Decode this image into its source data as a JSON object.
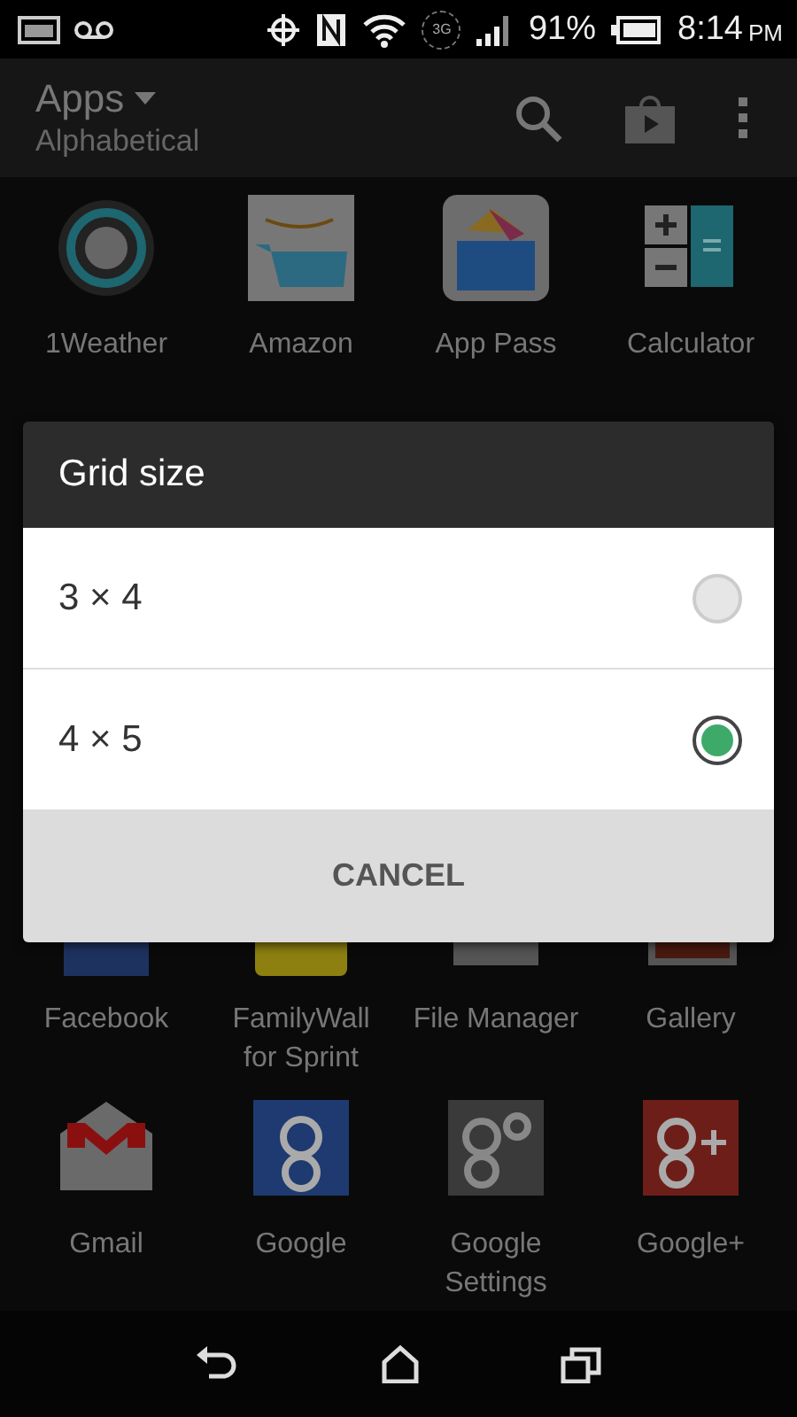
{
  "status_bar": {
    "network": "3G",
    "battery": "91%",
    "time": "8:14",
    "period": "PM"
  },
  "app_bar": {
    "title": "Apps",
    "subtitle": "Alphabetical"
  },
  "app_rows": [
    [
      {
        "label": "1Weather",
        "kind": "weather"
      },
      {
        "label": "Amazon",
        "kind": "cart"
      },
      {
        "label": "App Pass",
        "kind": "box"
      },
      {
        "label": "Calculator",
        "kind": "calc"
      }
    ],
    [
      {
        "label": "Facebook",
        "kind": "blue"
      },
      {
        "label": "FamilyWall\nfor Sprint",
        "kind": "yellow"
      },
      {
        "label": "File Manager",
        "kind": "grey"
      },
      {
        "label": "Gallery",
        "kind": "red"
      }
    ],
    [
      {
        "label": "Gmail",
        "kind": "mail"
      },
      {
        "label": "Google",
        "kind": "google"
      },
      {
        "label": "Google\nSettings",
        "kind": "gsettings"
      },
      {
        "label": "Google+",
        "kind": "gplus"
      }
    ]
  ],
  "dialog": {
    "title": "Grid size",
    "options": [
      {
        "label": "3 × 4",
        "selected": false
      },
      {
        "label": "4 × 5",
        "selected": true
      }
    ],
    "button": "CANCEL"
  }
}
